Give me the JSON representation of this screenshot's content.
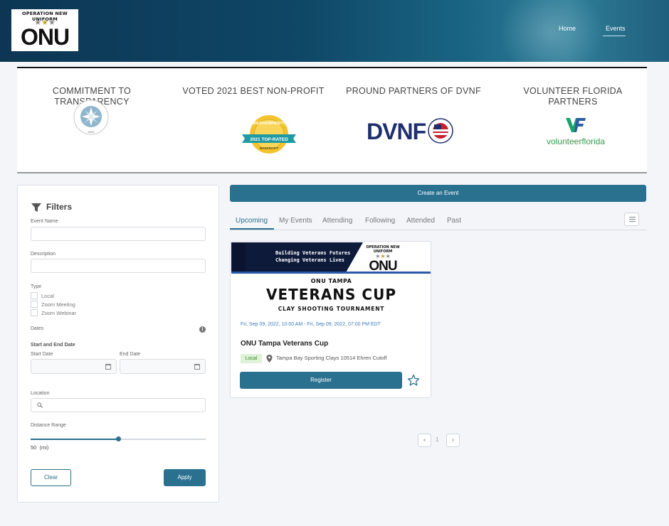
{
  "header": {
    "logo": {
      "arc_text": "OPERATION NEW UNIFORM",
      "wordmark": "ONU"
    },
    "nav": [
      {
        "label": "Home"
      },
      {
        "label": "Events"
      }
    ]
  },
  "badges": [
    {
      "title": "COMMITMENT TO TRANSPARENCY",
      "seal_text": "CANDID PLATINUM SEAL OF TRANSPARENCY",
      "seal_year": "2020"
    },
    {
      "title": "VOTED 2021 BEST NON-PROFIT",
      "seal_top": "GREATNONPROFITS",
      "seal_ribbon": "2021 TOP-RATED",
      "seal_bottom": "NONPROFIT"
    },
    {
      "title": "PROUND PARTNERS OF DVNF",
      "logo_text": "DVNF"
    },
    {
      "title": "VOLUNTEER FLORIDA PARTNERS",
      "logo_mark": "VF",
      "logo_text": "volunteerflorida"
    }
  ],
  "filters": {
    "title": "Filters",
    "event_name_label": "Event Name",
    "event_name_value": "",
    "description_label": "Description",
    "description_value": "",
    "type_label": "Type",
    "types": [
      "Local",
      "Zoom Meeting",
      "Zoom Webinar"
    ],
    "dates_label": "Dates",
    "start_end_label": "Start and End Date",
    "start_date_label": "Start Date",
    "end_date_label": "End Date",
    "location_label": "Location",
    "distance_label": "Distance Range",
    "distance_value": "50",
    "distance_unit": "(mi)",
    "distance_fraction": 0.5,
    "clear_label": "Clear",
    "apply_label": "Apply"
  },
  "main": {
    "create_label": "Create an Event",
    "tabs": [
      {
        "label": "Upcoming",
        "active": true
      },
      {
        "label": "My Events"
      },
      {
        "label": "Attending"
      },
      {
        "label": "Following"
      },
      {
        "label": "Attended"
      },
      {
        "label": "Past"
      }
    ],
    "event": {
      "banner_line1": "Building Veterans Futures",
      "banner_line2": "Changing Veterans Lives",
      "banner_logo_arc": "OPERATION NEW UNIFORM",
      "banner_logo_word": "ONU",
      "city": "ONU TAMPA",
      "headline": "VETERANS CUP",
      "subheadline": "CLAY SHOOTING TOURNAMENT",
      "datetime": "Fri, Sep 09, 2022, 10:00 AM - Fri, Sep 09, 2022, 07:00 PM EDT",
      "title": "ONU Tampa Veterans Cup",
      "type_badge": "Local",
      "location": "Tampa Bay Sporting Clays 10514 Ehren Cutoff",
      "register_label": "Register"
    },
    "pagination": {
      "current": "1",
      "prev_icon": "chevron-left-icon",
      "next_icon": "chevron-right-icon"
    }
  },
  "colors": {
    "primary": "#2a718f",
    "header_dark": "#0c3654",
    "date_link": "#3d7cb8",
    "badge_green_bg": "#dff1d8",
    "badge_green_text": "#3b8a2e"
  }
}
